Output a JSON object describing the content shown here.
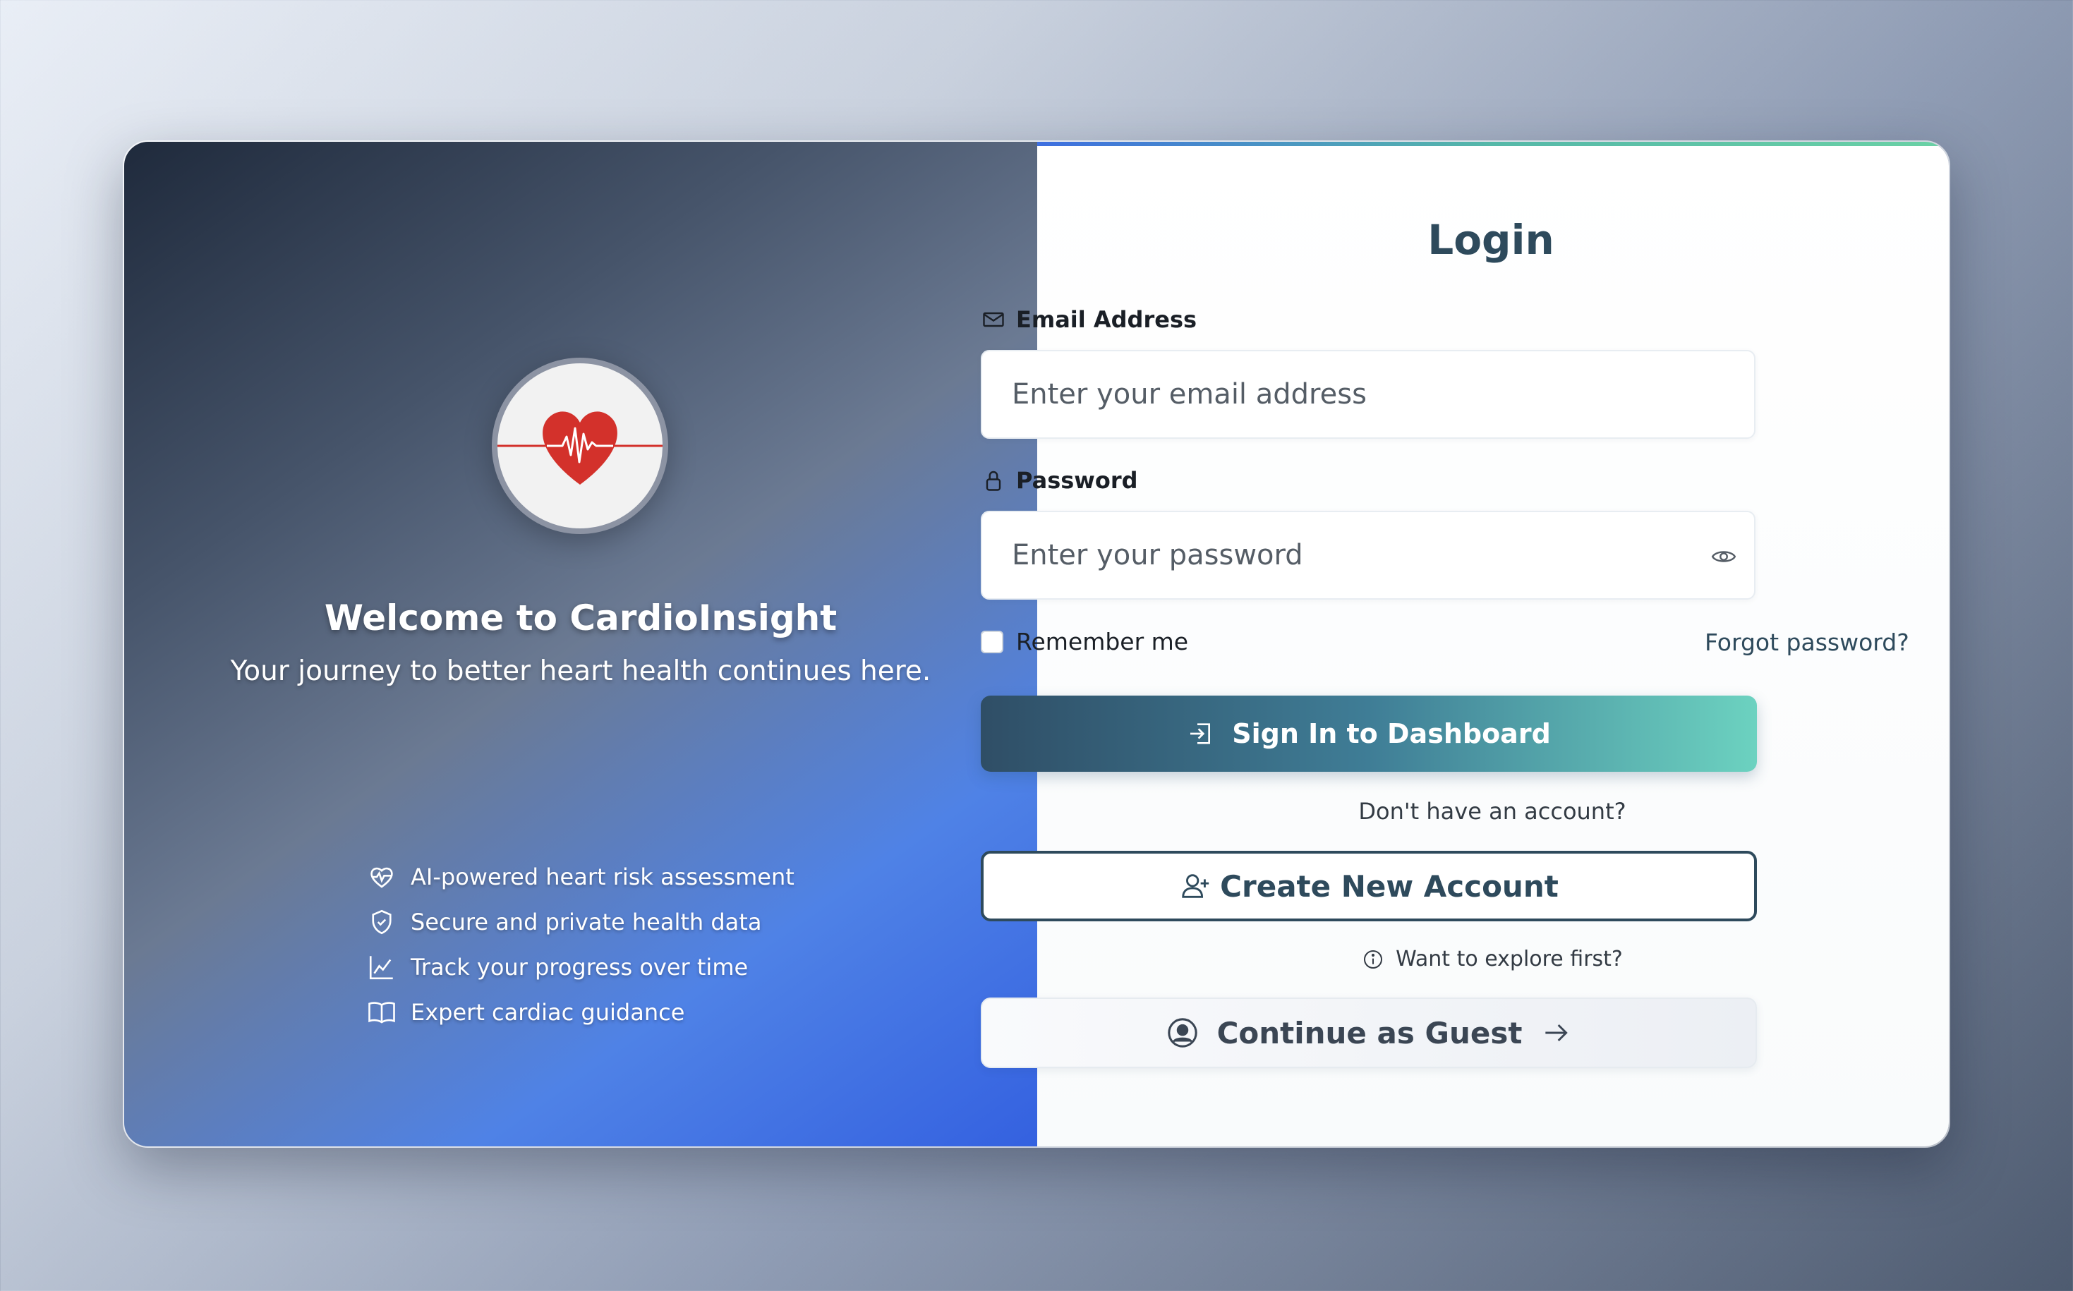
{
  "brand": {
    "welcome": "Welcome to CardioInsight",
    "tagline": "Your journey to better heart health continues here."
  },
  "features": [
    {
      "icon": "heart-pulse-icon",
      "label": "AI-powered heart risk assessment"
    },
    {
      "icon": "shield-check-icon",
      "label": "Secure and private health data"
    },
    {
      "icon": "line-chart-icon",
      "label": "Track your progress over time"
    },
    {
      "icon": "book-icon",
      "label": "Expert cardiac guidance"
    }
  ],
  "login": {
    "title": "Login",
    "email_label": "Email Address",
    "email_placeholder": "Enter your email address",
    "password_label": "Password",
    "password_placeholder": "Enter your password",
    "remember_label": "Remember me",
    "forgot_label": "Forgot password?",
    "sign_in_label": "Sign In to Dashboard",
    "no_account_text": "Don't have an account?",
    "create_account_label": "Create New Account",
    "explore_text": "Want to explore first?",
    "guest_label": "Continue as Guest"
  },
  "colors": {
    "primary": "#2e4a5c",
    "accent": "#6cd2c0",
    "heart": "#d3312b"
  }
}
